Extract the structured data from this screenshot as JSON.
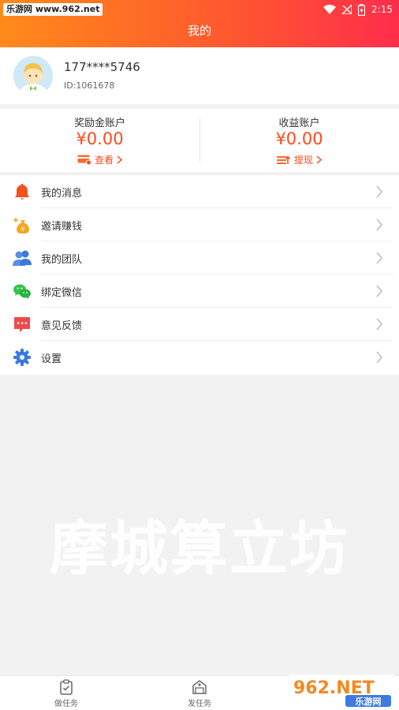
{
  "status_bar": {
    "site_text": "乐游网 www.962.net",
    "time": "2:15"
  },
  "header": {
    "title": "我的"
  },
  "profile": {
    "phone": "177****5746",
    "user_id": "ID:1061678"
  },
  "accounts": {
    "reward": {
      "name": "奖励金账户",
      "amount": "¥0.00",
      "link": "查看"
    },
    "earnings": {
      "name": "收益账户",
      "amount": "¥0.00",
      "link": "提现"
    }
  },
  "menu": [
    {
      "label": "我的消息",
      "icon": "bell-icon"
    },
    {
      "label": "邀请赚钱",
      "icon": "money-bag-icon"
    },
    {
      "label": "我的团队",
      "icon": "team-icon"
    },
    {
      "label": "绑定微信",
      "icon": "wechat-icon"
    },
    {
      "label": "意见反馈",
      "icon": "feedback-icon"
    },
    {
      "label": "设置",
      "icon": "gear-icon"
    }
  ],
  "watermark": "摩城算立坊",
  "bottom_nav": [
    {
      "label": "做任务",
      "icon": "clipboard-check-icon"
    },
    {
      "label": "发任务",
      "icon": "publish-task-icon"
    }
  ],
  "site_logo": {
    "top": "962.NET",
    "bottom": "乐游网"
  },
  "colors": {
    "accent": "#ff4a1f",
    "header_start": "#ff8a1a",
    "header_end": "#ff2d4b"
  }
}
